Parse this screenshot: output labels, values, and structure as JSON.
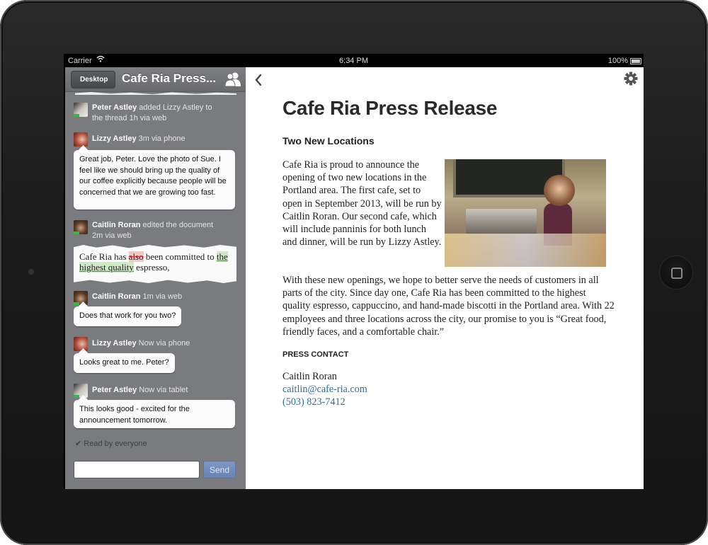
{
  "status_bar": {
    "carrier": "Carrier",
    "time": "6:34 PM",
    "battery": "100%"
  },
  "sidebar": {
    "back_label": "Desktop",
    "title": "Cafe Ria Press...",
    "feed": [
      {
        "type": "event",
        "author": "Peter Astley",
        "text": "added Lizzy Astley to",
        "text2": "the thread",
        "time": "1h via web"
      },
      {
        "type": "message",
        "author": "Lizzy Astley",
        "time": "3m via phone",
        "body": "Great job, Peter. Love the photo of Sue. I feel like we should bring up the quality of our coffee explicitly because people will be concerned that we are growing too fast."
      },
      {
        "type": "edit",
        "author": "Caitlin Roran",
        "text": "edited the document",
        "time": "2m via web",
        "snippet": {
          "before": "Cafe Ria has ",
          "deleted": "also",
          "middle": " been committed to ",
          "inserted": "the highest quality",
          "after": " espresso,"
        }
      },
      {
        "type": "message",
        "author": "Caitlin Roran",
        "time": "1m via web",
        "body": "Does that work for you two?"
      },
      {
        "type": "message",
        "author": "Lizzy Astley",
        "time": "Now via phone",
        "body": "Looks great to me. Peter?"
      },
      {
        "type": "message",
        "author": "Peter Astley",
        "time": "Now via tablet",
        "body": "This looks good - excited for the announcement tomorrow."
      }
    ],
    "read_receipt": "Read by everyone",
    "composer_placeholder": "",
    "send_label": "Send"
  },
  "document": {
    "title": "Cafe Ria Press Release",
    "subtitle": "Two New Locations",
    "paragraph1": "Cafe Ria is proud to announce the opening of two new locations in the Portland area. The first cafe, set to open in September 2013, will be run by Caitlin Roran. Our second cafe, which will include panninis for both lunch and dinner, will be run by Lizzy Astley.",
    "paragraph2": "With these new openings, we hope to better serve the needs of customers in all parts of the city. Since day one, Cafe Ria has been committed to the highest quality espresso, cappuccino, and hand-made biscotti in the Portland area. With 22 employees and three locations across the city, our promise to you is “Great food, friendly faces, and a comfortable chair.”",
    "contact_heading": "PRESS CONTACT",
    "contact_name": "Caitlin Roran",
    "contact_email": "caitlin@cafe-ria.com",
    "contact_phone": "(503) 823-7412"
  },
  "colors": {
    "link": "#2f6f98",
    "online": "#3bb54a",
    "send": "#6f8bbb",
    "sidebar_bg": "#7a7b7f"
  }
}
